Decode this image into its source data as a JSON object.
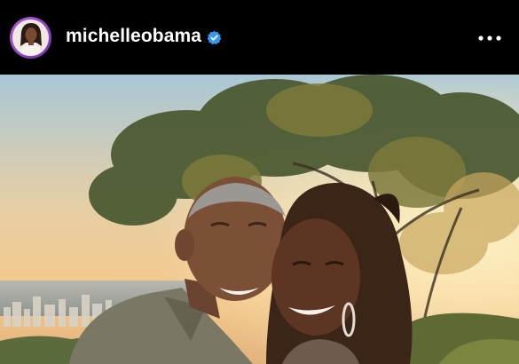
{
  "post": {
    "author": {
      "username": "michelleobama",
      "verified": true,
      "avatar_icon": "profile-avatar-icon",
      "verified_icon": "verified-badge-icon"
    },
    "more_options_icon": "more-options-icon",
    "photo_icon": "post-photo"
  },
  "colors": {
    "background": "#000000",
    "text": "#ffffff",
    "verified_badge": "#3897f0",
    "avatar_ring": "#b15cd6"
  }
}
